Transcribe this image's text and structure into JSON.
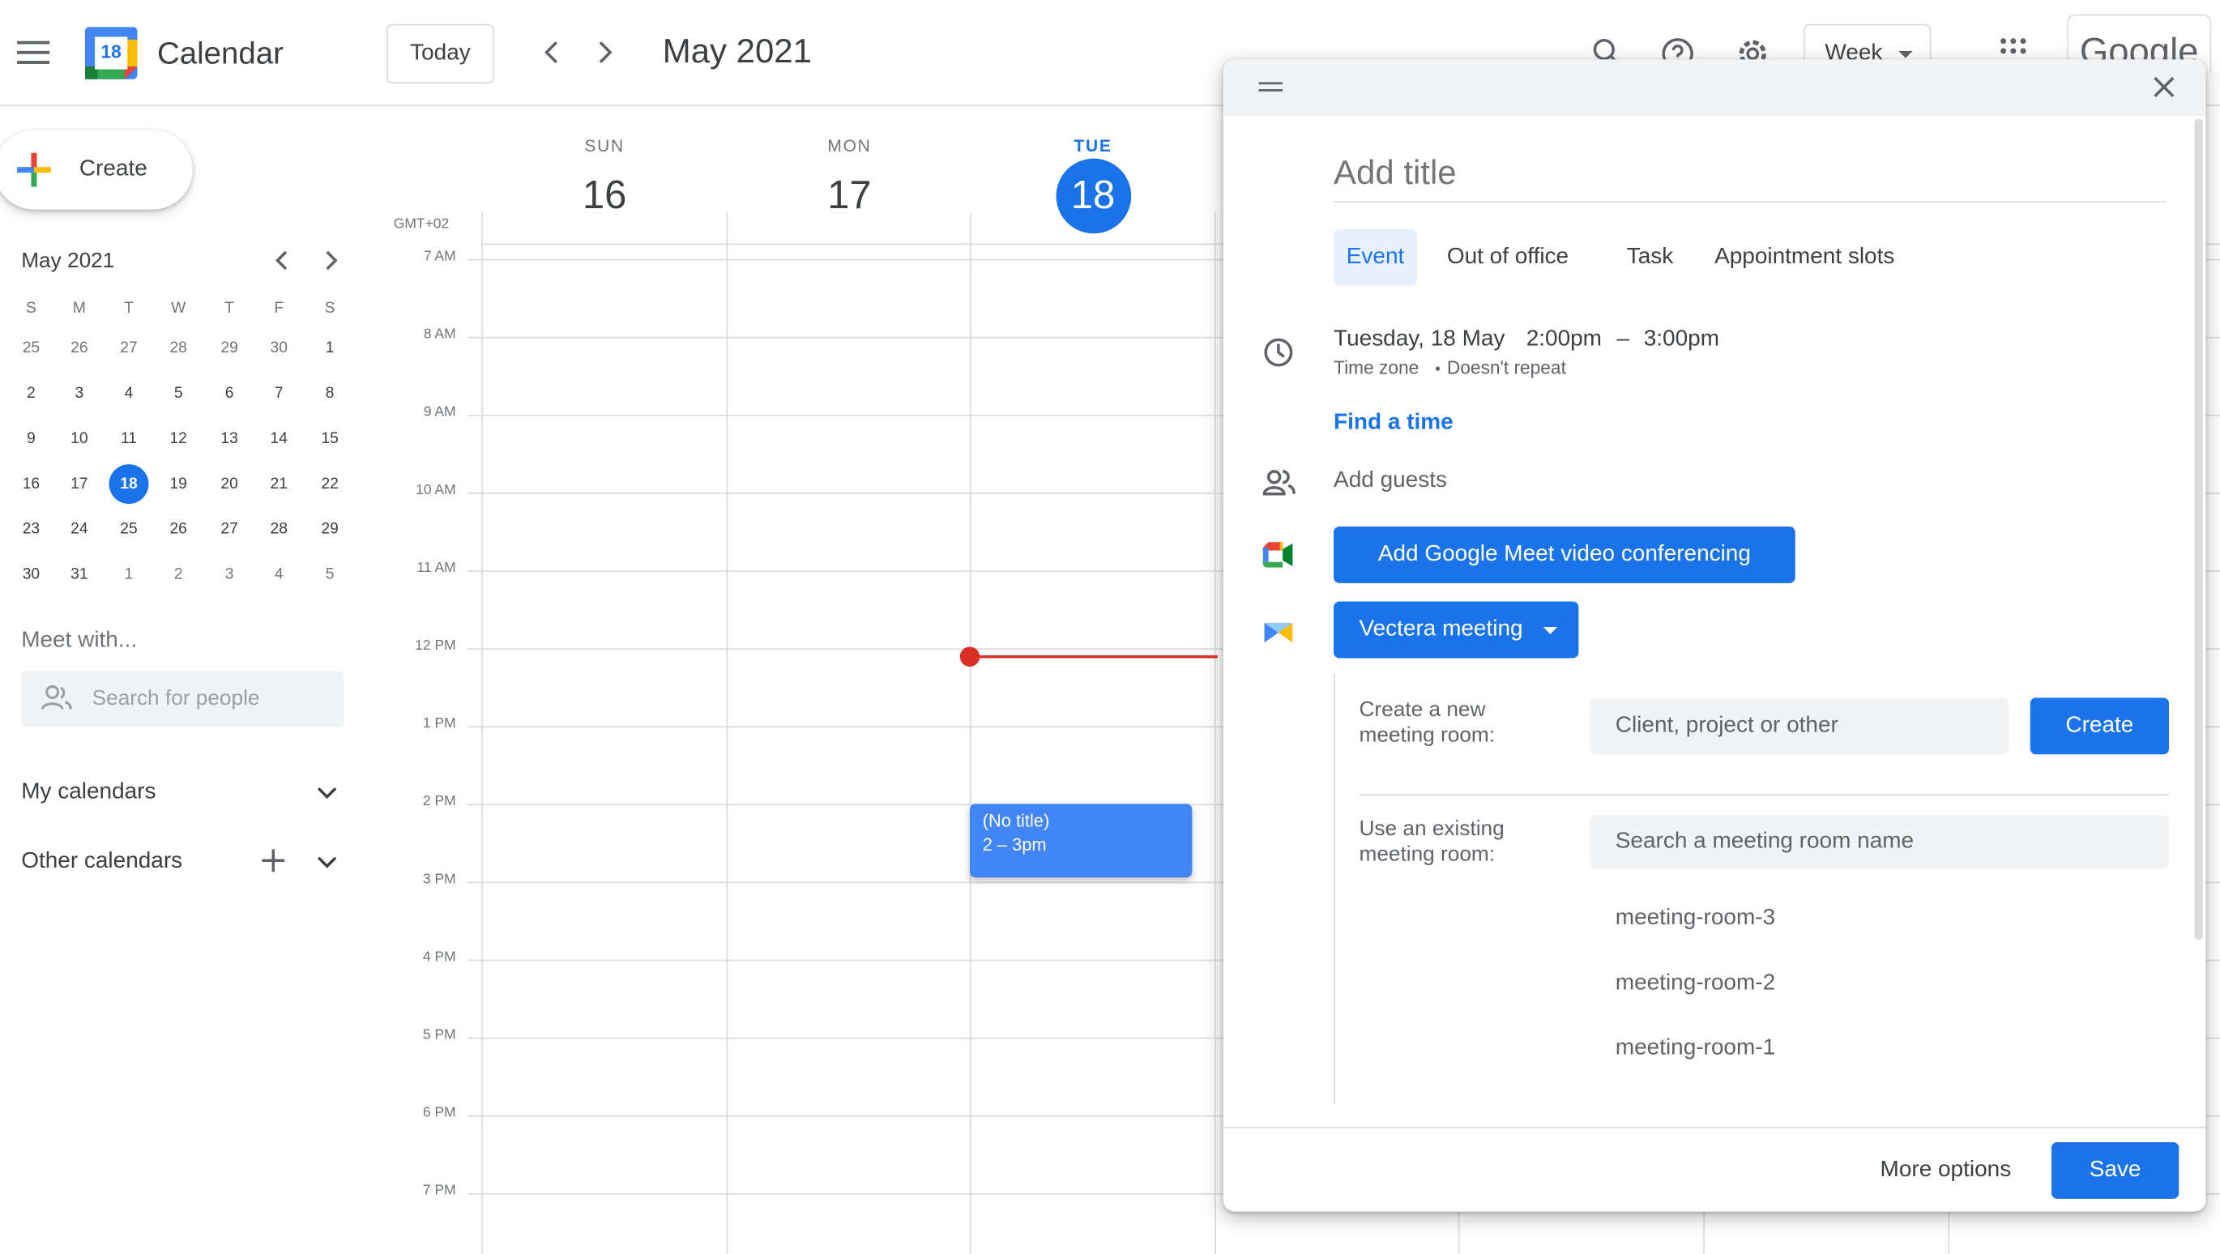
{
  "app": {
    "name": "Calendar",
    "logo_day": "18"
  },
  "header": {
    "today_label": "Today",
    "period": "May 2021",
    "view_label": "Week",
    "brand": "Google"
  },
  "sidebar": {
    "create_label": "Create",
    "mini": {
      "title": "May 2021",
      "weekdays": [
        "S",
        "M",
        "T",
        "W",
        "T",
        "F",
        "S"
      ],
      "weeks": [
        [
          "25",
          "26",
          "27",
          "28",
          "29",
          "30",
          "1"
        ],
        [
          "2",
          "3",
          "4",
          "5",
          "6",
          "7",
          "8"
        ],
        [
          "9",
          "10",
          "11",
          "12",
          "13",
          "14",
          "15"
        ],
        [
          "16",
          "17",
          "18",
          "19",
          "20",
          "21",
          "22"
        ],
        [
          "23",
          "24",
          "25",
          "26",
          "27",
          "28",
          "29"
        ],
        [
          "30",
          "31",
          "1",
          "2",
          "3",
          "4",
          "5"
        ]
      ],
      "today": "18"
    },
    "meet_with": "Meet with...",
    "search_people_placeholder": "Search for people",
    "my_calendars": "My calendars",
    "other_calendars": "Other calendars"
  },
  "week": {
    "timezone": "GMT+02",
    "days": [
      {
        "name": "SUN",
        "num": "16"
      },
      {
        "name": "MON",
        "num": "17"
      },
      {
        "name": "TUE",
        "num": "18"
      }
    ],
    "hours": [
      "7 AM",
      "8 AM",
      "9 AM",
      "10 AM",
      "11 AM",
      "12 PM",
      "1 PM",
      "2 PM",
      "3 PM",
      "4 PM",
      "5 PM",
      "6 PM",
      "7 PM"
    ],
    "event": {
      "title": "(No title)",
      "time": "2 – 3pm"
    }
  },
  "dialog": {
    "title_placeholder": "Add title",
    "tabs": [
      "Event",
      "Out of office",
      "Task",
      "Appointment slots"
    ],
    "active_tab": "Event",
    "date": "Tuesday, 18 May",
    "start": "2:00pm",
    "dash": "–",
    "end": "3:00pm",
    "timezone_link": "Time zone",
    "repeat": "Doesn't repeat",
    "find_time": "Find a time",
    "add_guests": "Add guests",
    "meet_button": "Add Google Meet video conferencing",
    "vectera_button": "Vectera meeting",
    "create_room_label": "Create a new meeting room:",
    "create_room_placeholder": "Client, project or other",
    "create_button": "Create",
    "existing_room_label": "Use an existing meeting room:",
    "existing_room_placeholder": "Search a meeting room name",
    "rooms": [
      "meeting-room-3",
      "meeting-room-2",
      "meeting-room-1"
    ],
    "more_options": "More options",
    "save": "Save"
  },
  "colors": {
    "accent": "#1a73e8",
    "event": "#4285f4",
    "now_line": "#d93025"
  }
}
